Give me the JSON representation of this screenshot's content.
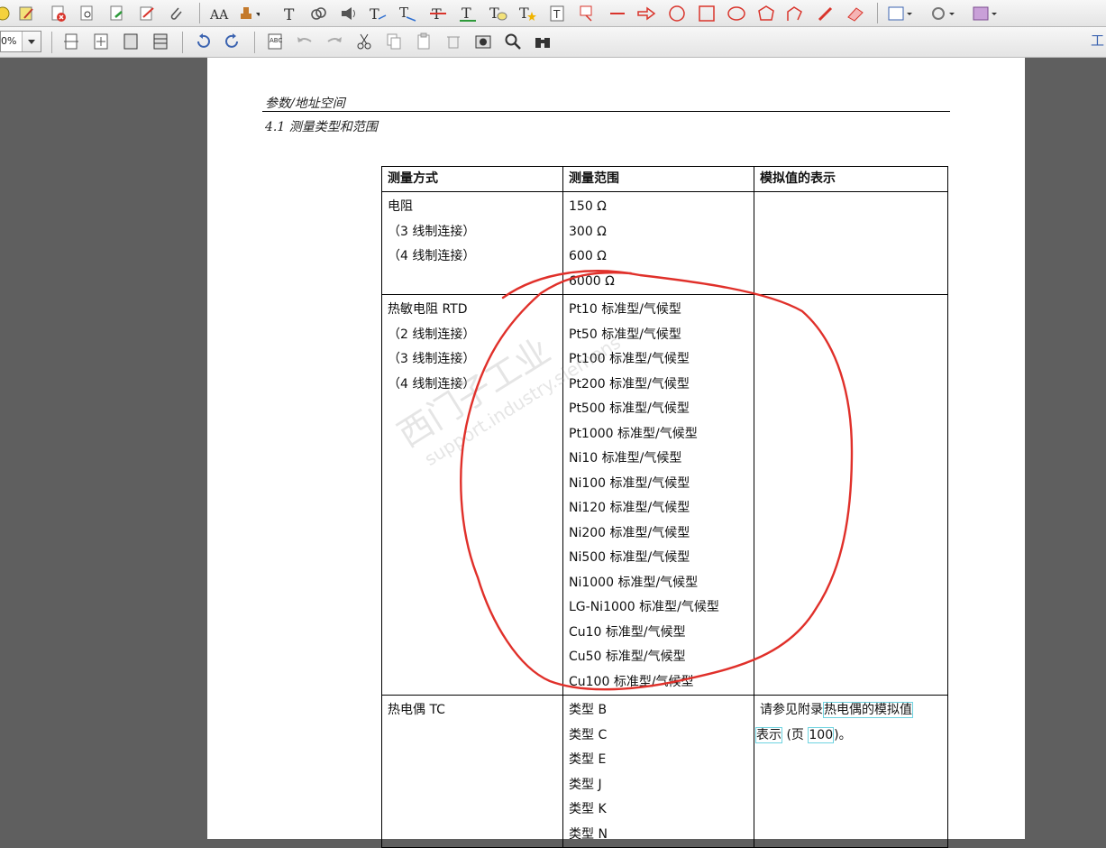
{
  "toolbar": {
    "zoom_value": "0%",
    "right_edge_label": "工"
  },
  "page": {
    "header_section": "参数/地址空间",
    "header_subsection": "4.1 测量类型和范围",
    "watermark_cn": "西门子工业",
    "watermark_url": "support.industry.siemens"
  },
  "table": {
    "headers": [
      "测量方式",
      "测量范围",
      "模拟值的表示"
    ],
    "rows": [
      {
        "method": [
          "电阻",
          "（3 线制连接）",
          "（4 线制连接）"
        ],
        "ranges": [
          "150 Ω",
          "300 Ω",
          "600 Ω",
          "6000 Ω"
        ],
        "analog": ""
      },
      {
        "method": [
          "热敏电阻 RTD",
          "（2 线制连接）",
          "（3 线制连接）",
          "（4 线制连接）"
        ],
        "ranges": [
          "Pt10 标准型/气候型",
          "Pt50 标准型/气候型",
          "Pt100 标准型/气候型",
          "Pt200 标准型/气候型",
          "Pt500 标准型/气候型",
          "Pt1000 标准型/气候型",
          "Ni10 标准型/气候型",
          "Ni100 标准型/气候型",
          "Ni120 标准型/气候型",
          "Ni200 标准型/气候型",
          "Ni500 标准型/气候型",
          "Ni1000 标准型/气候型",
          "LG-Ni1000 标准型/气候型",
          "Cu10 标准型/气候型",
          "Cu50 标准型/气候型",
          "Cu100 标准型/气候型"
        ],
        "analog": ""
      },
      {
        "method": [
          "热电偶 TC"
        ],
        "ranges": [
          "类型 B",
          "类型 C",
          "类型 E",
          "类型 J",
          "类型 K",
          "类型 N"
        ],
        "analog_prefix": "请参见附录",
        "analog_link1": "热电偶的模拟值",
        "analog_link2": "表示",
        "analog_mid": " (页 ",
        "analog_page": "100",
        "analog_suffix": ")。"
      }
    ]
  },
  "annotation_color": "#e0302a"
}
